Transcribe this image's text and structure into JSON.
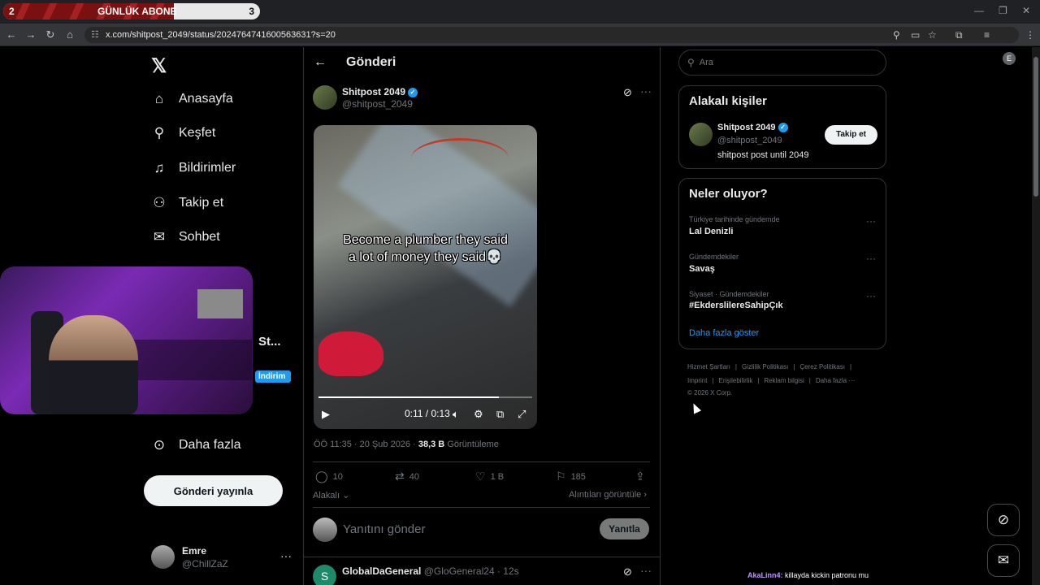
{
  "browser": {
    "tab": {
      "left_number": "2",
      "label": "GÜNLÜK ABONE",
      "right_number": "3"
    },
    "url": "x.com/shitpost_2049/status/2024764741600563631?s=20"
  },
  "nav": {
    "items": [
      {
        "label": "Anasayfa",
        "icon": "home-icon"
      },
      {
        "label": "Keşfet",
        "icon": "search-icon"
      },
      {
        "label": "Bildirimler",
        "icon": "bell-icon"
      },
      {
        "label": "Takip et",
        "icon": "add-user-icon"
      },
      {
        "label": "Sohbet",
        "icon": "mail-icon"
      },
      {
        "label": "Daha fazla",
        "icon": "more-circle-icon"
      }
    ],
    "partial_text": "St...",
    "badge": "İndirim",
    "post_button": "Gönderi yayınla",
    "user": {
      "name": "Emre",
      "handle": "@ChillZaZ",
      "more": "···"
    }
  },
  "header": {
    "title": "Gönderi"
  },
  "tweet": {
    "name": "Shitpost 2049",
    "handle": "@shitpost_2049",
    "caption_line1": "Become a plumber they said",
    "caption_line2": "a lot of money they said💀",
    "video_time": "0:11 / 0:13",
    "progress": 0.846,
    "meta_date": "ÖÖ 11:35 · 20 Şub 2026 · ",
    "views": "38,3 B",
    "views_label": "Görüntüleme",
    "replies": "10",
    "retweets": "40",
    "likes": "1 B",
    "bookmarks": "185",
    "related": "Alakalı",
    "quotes": "Alıntıları görüntüle"
  },
  "reply": {
    "placeholder": "Yanıtını gönder",
    "button": "Yanıtla"
  },
  "next_tweet": {
    "avatar_letter": "S",
    "name": "GlobalDaGeneral",
    "handle_time": "@GloGeneral24 · 12s"
  },
  "sidebar": {
    "search_placeholder": "Ara",
    "related_title": "Alakalı kişiler",
    "related_person": {
      "name": "Shitpost 2049",
      "handle": "@shitpost_2049",
      "bio": "shitpost post until 2049",
      "follow": "Takip et"
    },
    "trends_title": "Neler oluyor?",
    "trends": [
      {
        "category": "Türkiye tarihinde gündemde",
        "name": "Lal Denizli"
      },
      {
        "category": "Gündemdekiler",
        "name": "Savaş"
      },
      {
        "category": "Siyaset · Gündemdekiler",
        "name": "#EkderslilereSahipÇık"
      }
    ],
    "show_more": "Daha fazla göster",
    "footer_line1": [
      "Hizmet Şartları",
      "|",
      "Gizlilik Politikası",
      "|",
      "Çerez Politikası",
      "|"
    ],
    "footer_line2": [
      "Imprint",
      "|",
      "Erişilebilirlik",
      "|",
      "Reklam bilgisi",
      "|",
      "Daha fazla ···"
    ],
    "copyright": "© 2026 X Corp."
  },
  "chat": {
    "user": "AkaLinn4:",
    "text": " killayda kickin patronu mu"
  }
}
